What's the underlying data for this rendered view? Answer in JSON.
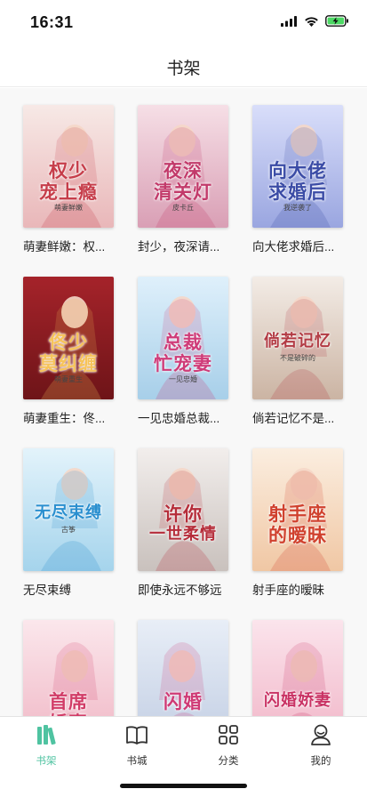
{
  "status": {
    "time": "16:31"
  },
  "nav": {
    "title": "书架"
  },
  "books": [
    {
      "title": "萌妻鲜嫩：权...",
      "cover_text": [
        "权少",
        "宠上瘾"
      ],
      "cover_sub": "萌妻鲜嫩",
      "colors": [
        "#f7e9e6",
        "#e9b7b9",
        "#c63d4a"
      ]
    },
    {
      "title": "封少，夜深请...",
      "cover_text": [
        "夜深",
        "清关灯"
      ],
      "cover_sub": "皮卡丘",
      "colors": [
        "#f6dfe6",
        "#d99fb5",
        "#c23a6a"
      ]
    },
    {
      "title": "向大佬求婚后...",
      "cover_text": [
        "向大佬",
        "求婚后"
      ],
      "cover_sub": "我逆袭了",
      "colors": [
        "#d9defa",
        "#9aa6e0",
        "#3b4ca6"
      ]
    },
    {
      "title": "萌妻重生：佟...",
      "cover_text": [
        "佟少",
        "莫纠缠"
      ],
      "cover_sub": "萌妻重生",
      "colors": [
        "#a5232a",
        "#6e1418",
        "#f6c35a"
      ]
    },
    {
      "title": "一见忠婚总裁...",
      "cover_text": [
        "总裁",
        "忙宠妻"
      ],
      "cover_sub": "一见忠婚",
      "colors": [
        "#dff0fb",
        "#a7cfe9",
        "#cf3b78"
      ]
    },
    {
      "title": "倘若记忆不是...",
      "cover_text": [
        "倘若记忆"
      ],
      "cover_sub": "不是破碎的",
      "colors": [
        "#f3ece6",
        "#cbb4a3",
        "#b23a43"
      ]
    },
    {
      "title": "无尽束缚",
      "cover_text": [
        "无尽束缚"
      ],
      "cover_sub": "古筝",
      "colors": [
        "#e3f3fb",
        "#a5d4ec",
        "#2a8fcf"
      ]
    },
    {
      "title": "即使永远不够远",
      "cover_text": [
        "许你",
        "一世柔情"
      ],
      "cover_sub": "",
      "colors": [
        "#f2eeec",
        "#c9c1bd",
        "#b52c39"
      ]
    },
    {
      "title": "射手座的暧昧",
      "cover_text": [
        "射手座",
        "的暧昧"
      ],
      "cover_sub": "",
      "colors": [
        "#fbeee0",
        "#f0c7a4",
        "#d0412e"
      ]
    },
    {
      "title": "",
      "cover_text": [
        "首席",
        "娇妻"
      ],
      "cover_sub": "",
      "colors": [
        "#fbe7ec",
        "#f0b8c6",
        "#d13c67"
      ]
    },
    {
      "title": "",
      "cover_text": [
        "闪婚"
      ],
      "cover_sub": "",
      "colors": [
        "#e8eef7",
        "#c3cfe4",
        "#cf3a75"
      ]
    },
    {
      "title": "",
      "cover_text": [
        "闪婚娇妻"
      ],
      "cover_sub": "",
      "colors": [
        "#fbe4ec",
        "#f1b6c8",
        "#c93264"
      ]
    }
  ],
  "tabs": [
    {
      "label": "书架",
      "icon": "bookshelf-icon",
      "active": true
    },
    {
      "label": "书城",
      "icon": "book-open-icon",
      "active": false
    },
    {
      "label": "分类",
      "icon": "grid-icon",
      "active": false
    },
    {
      "label": "我的",
      "icon": "user-icon",
      "active": false
    }
  ],
  "accent": "#4fc3a1"
}
